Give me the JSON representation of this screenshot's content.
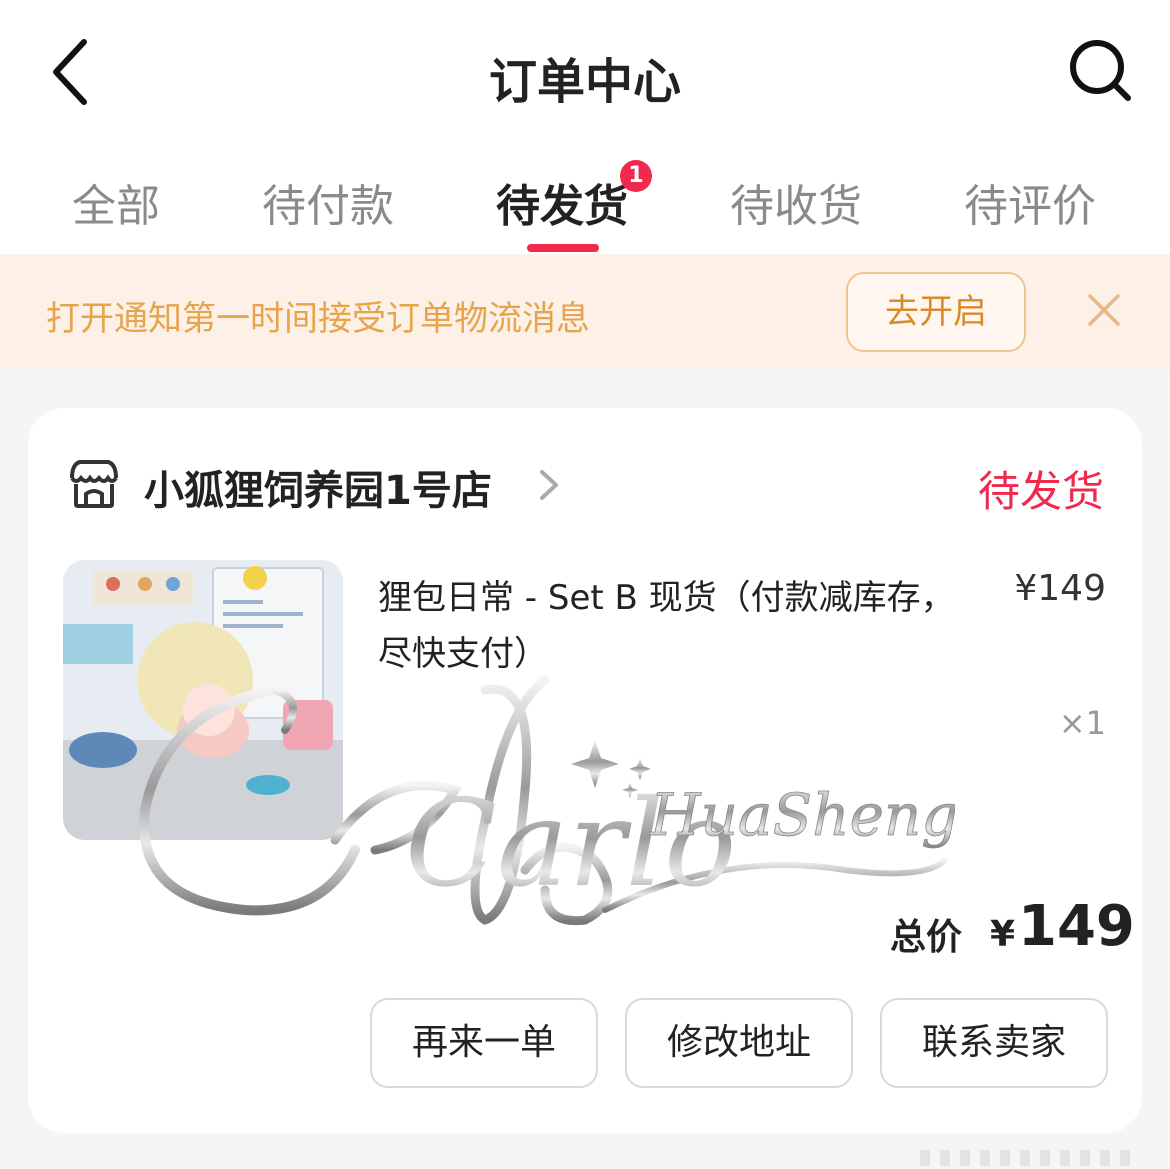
{
  "header": {
    "title": "订单中心",
    "back_icon": "chevron-left-icon",
    "search_icon": "search-icon"
  },
  "tabs": [
    {
      "label": "全部",
      "active": false
    },
    {
      "label": "待付款",
      "active": false
    },
    {
      "label": "待发货",
      "active": true,
      "badge": "1"
    },
    {
      "label": "待收货",
      "active": false
    },
    {
      "label": "待评价",
      "active": false
    }
  ],
  "notice": {
    "text": "打开通知第一时间接受订单物流消息",
    "button_label": "去开启",
    "close_icon": "close-icon"
  },
  "order": {
    "shop_name": "小狐狸饲养园1号店",
    "shop_icon": "store-icon",
    "status": "待发货",
    "product": {
      "title": "狸包日常 - Set B 现货（付款减库存，尽快支付）",
      "unit_price": "¥149",
      "quantity": "×1"
    },
    "total_label": "总价",
    "total_currency": "¥",
    "total_value": "149",
    "actions": [
      "再来一单",
      "修改地址",
      "联系卖家"
    ]
  },
  "watermark": {
    "script": "Carlo",
    "name": "HuaSheng"
  },
  "colors": {
    "accent": "#f0294d",
    "notice_bg": "#fdf0e6",
    "notice_text": "#e6a44c",
    "page_bg": "#f5f5f5"
  }
}
